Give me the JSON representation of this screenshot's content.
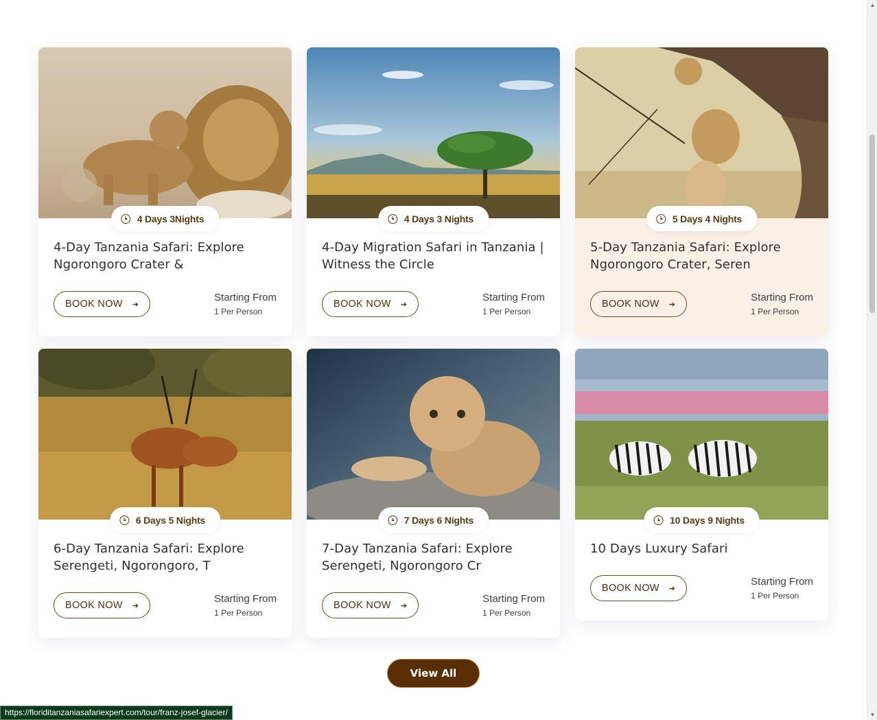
{
  "tours": [
    {
      "title": "4-Day Tanzania Safari: Explore Ngorongoro Crater &",
      "duration": "4 Days 3Nights",
      "book_label": "BOOK NOW",
      "price_label": "Starting From",
      "price_unit": "1 Per Person",
      "image": "lion-and-cub",
      "highlighted": false
    },
    {
      "title": "4-Day Migration Safari in Tanzania | Witness the Circle",
      "duration": "4 Days 3 Nights",
      "book_label": "BOOK NOW",
      "price_label": "Starting From",
      "price_unit": "1 Per Person",
      "image": "savanna-acacia-migration",
      "highlighted": false
    },
    {
      "title": "5-Day Tanzania Safari: Explore Ngorongoro Crater, Seren",
      "duration": "5 Days 4 Nights",
      "book_label": "BOOK NOW",
      "price_label": "Starting From",
      "price_unit": "1 Per Person",
      "image": "lion-cub-in-tree",
      "highlighted": true
    },
    {
      "title": "6-Day Tanzania Safari: Explore Serengeti, Ngorongoro, T",
      "duration": "6 Days 5 Nights",
      "book_label": "BOOK NOW",
      "price_label": "Starting From",
      "price_unit": "1 Per Person",
      "image": "impalas-in-grass",
      "highlighted": false
    },
    {
      "title": "7-Day Tanzania Safari: Explore Serengeti, Ngorongoro Cr",
      "duration": "7 Days 6 Nights",
      "book_label": "BOOK NOW",
      "price_label": "Starting From",
      "price_unit": "1 Per Person",
      "image": "lion-cub-on-rock",
      "highlighted": false
    },
    {
      "title": "10 Days Luxury Safari",
      "duration": "10 Days 9 Nights",
      "book_label": "BOOK NOW",
      "price_label": "Starting From",
      "price_unit": "1 Per Person",
      "image": "zebras-and-flamingos",
      "highlighted": false
    }
  ],
  "view_all_label": "View All",
  "status_url": "https://floriditanzaniasafariexpert.com/tour/franz-josef-glacier/",
  "colors": {
    "brand_brown": "#5a2e04",
    "accent_border": "#b57a2a",
    "highlight_card": "#fbf0e6",
    "text_brown": "#5a3a10"
  }
}
